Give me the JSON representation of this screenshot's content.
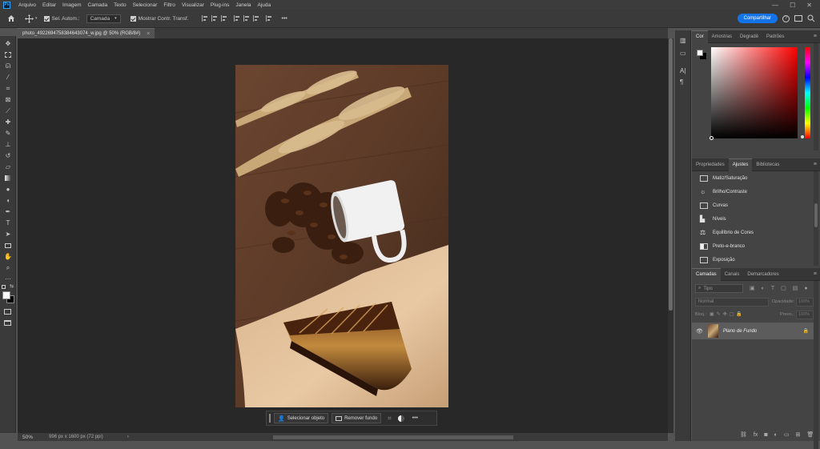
{
  "app": {
    "logo": "Ps"
  },
  "menu": [
    "Arquivo",
    "Editar",
    "Imagem",
    "Camada",
    "Texto",
    "Selecionar",
    "Filtro",
    "Visualizar",
    "Plug-ins",
    "Janela",
    "Ajuda"
  ],
  "window_controls": [
    "—",
    "☐",
    "✕"
  ],
  "options": {
    "auto_select_label": "Sel. Autom.:",
    "auto_select_value": "Camada",
    "show_transform_label": "Mostrar Contr. Transf.",
    "more": "•••",
    "share_label": "Compartilhar"
  },
  "document": {
    "tab_title": "photo_4922694758384643074_w.jpg @ 50% (RGB/8#)",
    "close": "×",
    "zoom": "50%",
    "info": "996 px x 1600 px (72 ppi)"
  },
  "context_bar": {
    "select_object": "Selecionar objeto",
    "remove_background": "Remover fundo",
    "more": "•••"
  },
  "color_panel": {
    "tabs": [
      "Cor",
      "Amostras",
      "Degradê",
      "Padrões"
    ],
    "foreground": "#ffffff",
    "background": "#000000",
    "hue": "#ff0000"
  },
  "adjust_panel": {
    "tabs": [
      "Propriedades",
      "Ajustes",
      "Bibliotecas"
    ],
    "items": [
      "Matiz/Saturação",
      "Brilho/Contraste",
      "Curvas",
      "Níveis",
      "Equilíbrio de Cores",
      "Preto-e-branco",
      "Exposição"
    ]
  },
  "layers_panel": {
    "tabs": [
      "Camadas",
      "Canais",
      "Demarcadores"
    ],
    "search_placeholder": "Tipo",
    "blend_mode": "Normal",
    "opacity_label": "Opacidade:",
    "opacity_value": "100%",
    "lock_label": "Bloq.:",
    "fill_label": "Preen.:",
    "fill_value": "100%",
    "layer_name": "Plano de Fundo"
  },
  "colors": {
    "accent": "#1473e6",
    "panel": "#444444",
    "canvas_bg": "#282828"
  }
}
